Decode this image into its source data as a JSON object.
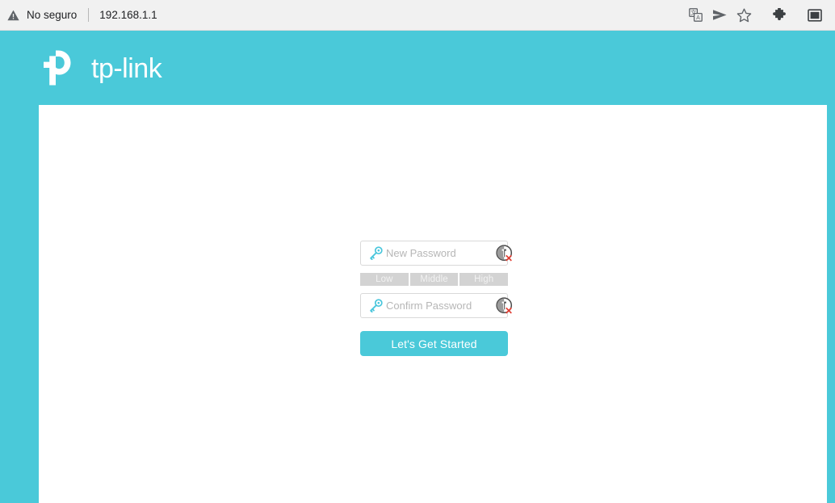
{
  "browser": {
    "security_label": "No seguro",
    "url": "192.168.1.1",
    "icons": {
      "warning": "warning-triangle-icon",
      "translate": "translate-icon",
      "send": "send-icon",
      "bookmark": "star-icon",
      "extensions": "puzzle-icon",
      "sidepanel": "side-panel-icon"
    }
  },
  "brand": {
    "name": "tp-link"
  },
  "form": {
    "new_password": {
      "placeholder": "New Password",
      "value": ""
    },
    "confirm_password": {
      "placeholder": "Confirm Password",
      "value": ""
    },
    "strength": {
      "low": "Low",
      "middle": "Middle",
      "high": "High"
    },
    "submit_label": "Let's Get Started"
  },
  "colors": {
    "brand_teal": "#4ac9d9",
    "browser_bar": "#f1f1f1",
    "strength_grey": "#d3d3d3",
    "placeholder_grey": "#b6b6b6",
    "error_red": "#e03c31"
  }
}
